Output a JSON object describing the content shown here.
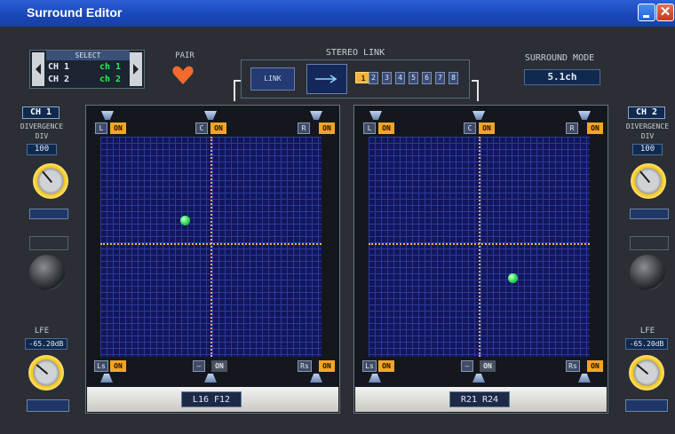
{
  "window": {
    "title": "Surround Editor"
  },
  "select": {
    "label": "SELECT",
    "rows": [
      {
        "ch": "CH 1",
        "name": "ch 1"
      },
      {
        "ch": "CH 2",
        "name": "ch 2"
      }
    ]
  },
  "pair": {
    "label": "PAIR"
  },
  "stereo_link": {
    "label": "STEREO LINK",
    "link_button": "LINK",
    "numbers": [
      "1",
      "2",
      "3",
      "4",
      "5",
      "6",
      "7",
      "8"
    ],
    "active": "1"
  },
  "surround_mode": {
    "label": "SURROUND MODE",
    "value": "5.1ch"
  },
  "left_strip": {
    "channel": "CH 1",
    "divergence_label": "DIVERGENCE",
    "div_label": "DIV",
    "div_value": "100",
    "lfe_label": "LFE",
    "lfe_value": "-65.20dB"
  },
  "right_strip": {
    "channel": "CH 2",
    "divergence_label": "DIVERGENCE",
    "div_label": "DIV",
    "div_value": "100",
    "lfe_label": "LFE",
    "lfe_value": "-65.20dB"
  },
  "panners": [
    {
      "speakers": {
        "L": "L",
        "C": "C",
        "R": "R",
        "Ls": "Ls",
        "sub": "—",
        "Rs": "Rs"
      },
      "on": {
        "L": "ON",
        "C": "ON",
        "R": "ON",
        "Ls": "ON",
        "sub": "ON",
        "Rs": "ON"
      },
      "position_label": "L16 F12",
      "pan_x": 0.38,
      "pan_y": 0.38
    },
    {
      "speakers": {
        "L": "L",
        "C": "C",
        "R": "R",
        "Ls": "Ls",
        "sub": "—",
        "Rs": "Rs"
      },
      "on": {
        "L": "ON",
        "C": "ON",
        "R": "ON",
        "Ls": "ON",
        "sub": "ON",
        "Rs": "ON"
      },
      "position_label": "R21 R24",
      "pan_x": 0.65,
      "pan_y": 0.64
    }
  ],
  "colors": {
    "on_active": "#f3a526",
    "grid_bg": "#13165c",
    "select_green": "#27f04e",
    "heart": "#f36a2c"
  }
}
